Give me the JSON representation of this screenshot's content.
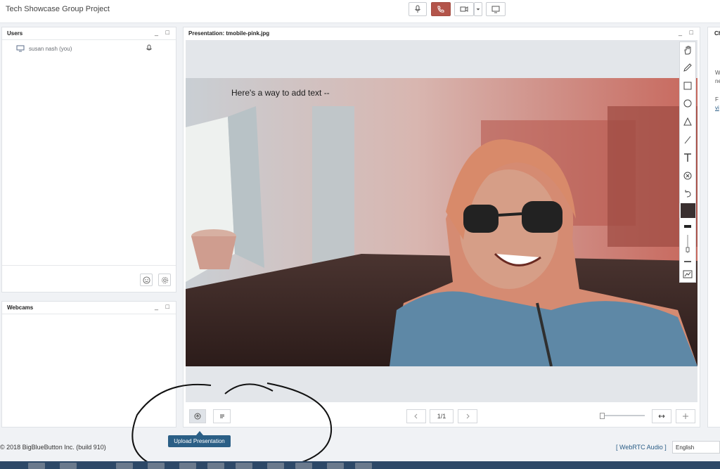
{
  "app": {
    "title": "Tech Showcase Group Project"
  },
  "media_controls": [
    {
      "name": "microphone-button",
      "icon": "microphone-icon"
    },
    {
      "name": "hangup-button",
      "icon": "phone-icon"
    },
    {
      "name": "camera-button",
      "icon": "video-camera-icon"
    },
    {
      "name": "camera-dropdown-button",
      "icon": "caret-down-icon"
    },
    {
      "name": "screenshare-button",
      "icon": "monitor-icon"
    }
  ],
  "users_panel": {
    "title": "Users",
    "controls": "_ □",
    "users": [
      {
        "name": "susan nash (you)",
        "icon": "monitor-icon",
        "status_icon": "microphone-icon"
      }
    ],
    "bottom_buttons": [
      "smiley-icon",
      "gear-icon"
    ]
  },
  "webcams_panel": {
    "title": "Webcams",
    "controls": "_ □"
  },
  "presentation_panel": {
    "title": "Presentation: tmobile-pink.jpg",
    "controls": "_ □",
    "slide_text": "Here's a way to add text --",
    "page_indicator": "1/1",
    "tools": [
      "hand-icon",
      "pencil-icon",
      "rectangle-icon",
      "ellipse-icon",
      "triangle-icon",
      "line-icon",
      "text-icon",
      "clear-icon",
      "undo-icon",
      "color-swatch-icon",
      "thickness-icon",
      "slider-icon",
      "line-thin-icon",
      "chart-icon"
    ],
    "accent_color": "#3a3030"
  },
  "chat_panel": {
    "title": "Ch",
    "partial_text": [
      "W",
      "ne",
      "F",
      "vi"
    ]
  },
  "tooltip": {
    "text": "Upload Presentation"
  },
  "footer": {
    "copyright": "© 2018 BigBlueButton Inc. (build 910)",
    "webrtc": "[ WebRTC Audio ]",
    "language": "English"
  },
  "colors": {
    "hangup": "#b3544a",
    "tooltip": "#2b5f86",
    "annotation": "#111111"
  }
}
